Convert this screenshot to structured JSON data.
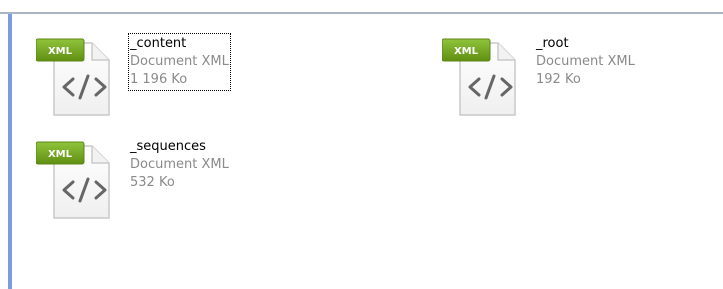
{
  "files": [
    {
      "name": "_content",
      "type": "Document XML",
      "size": "1 196 Ko",
      "icon": "xml-file-icon",
      "badge": "XML"
    },
    {
      "name": "_root",
      "type": "Document XML",
      "size": "192 Ko",
      "icon": "xml-file-icon",
      "badge": "XML"
    },
    {
      "name": "_sequences",
      "type": "Document XML",
      "size": "532 Ko",
      "icon": "xml-file-icon",
      "badge": "XML"
    }
  ],
  "colors": {
    "badge_green": "#6a9f1a",
    "blue_strip": "#7b9ce2",
    "text_gray": "#8a8a8a"
  }
}
